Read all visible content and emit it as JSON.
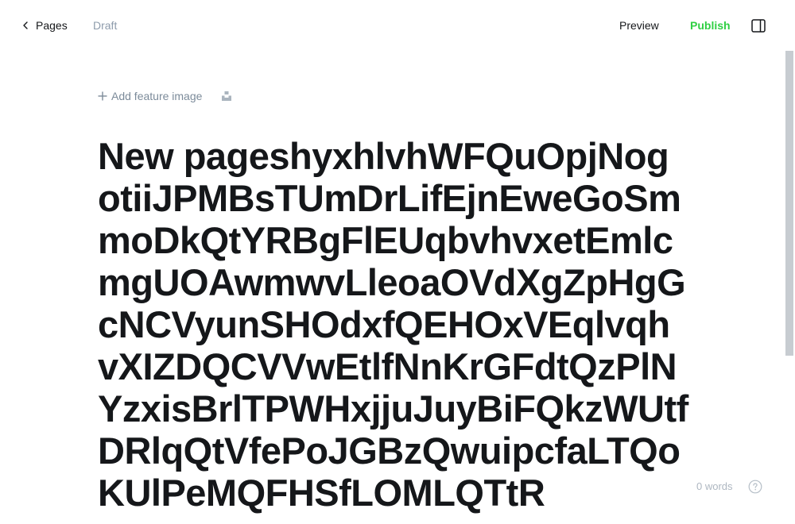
{
  "topbar": {
    "back_label": "Pages",
    "status": "Draft",
    "preview_label": "Preview",
    "publish_label": "Publish",
    "sidebar_toggle_icon": "sidebar-toggle-icon"
  },
  "editor": {
    "add_feature_image_label": "Add feature image",
    "title": "New pageshyxhlvhWFQuOpjNogotiiJPMBsTUmDrLifEjnEweGoSmmoDkQtYRBgFlEUqbvhvxetEmlcmgUOAwmwvLleoaOVdXgZpHgGcNCVyunSHOdxfQEHOxVEqlvqhvXIZDQCVVwEtlfNnKrGFdtQzPlNYzxisBrlTPWHxjjuJuyBiFQkzWUtfDRlqQtVfePoJGBzQwuipcfaLTQoKUlPeMQFHSfLOMLQTtR"
  },
  "footer": {
    "word_count": "0 words"
  },
  "colors": {
    "accent_publish": "#30cf43",
    "muted_text": "#8e9cac",
    "title_text": "#15171a"
  }
}
